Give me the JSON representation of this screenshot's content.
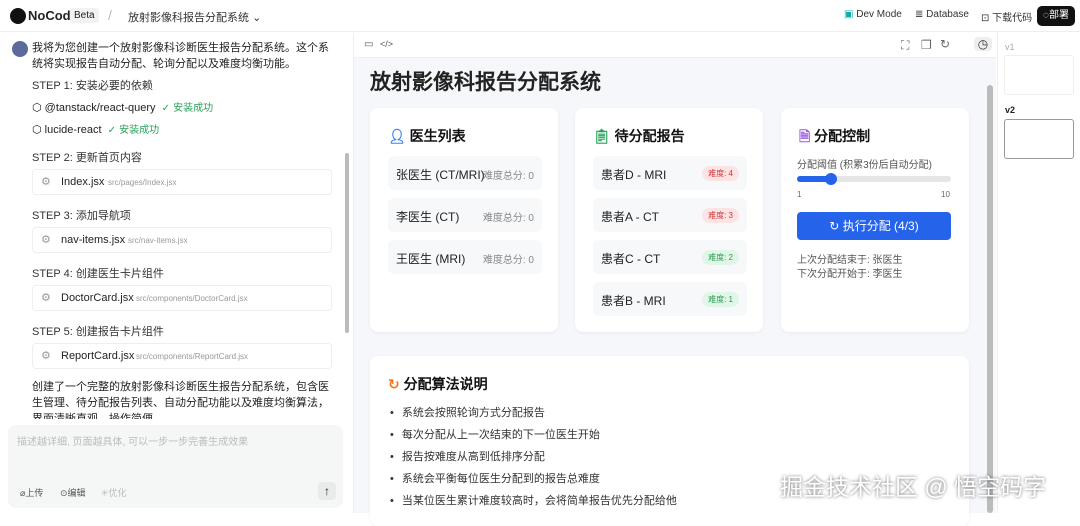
{
  "topbar": {
    "brand": "NoCode",
    "beta": "Beta",
    "project": "放射影像科报告分配系统",
    "dev_mode": "Dev Mode",
    "database": "Database",
    "download": "下载代码",
    "deploy": "部署"
  },
  "chat": {
    "intro": "我将为您创建一个放射影像科诊断医生报告分配系统。这个系统将实现报告自动分配、轮询分配以及难度均衡功能。",
    "step1": "STEP 1: 安装必要的依赖",
    "deps": [
      {
        "name": "@tanstack/react-query",
        "status": "安装成功"
      },
      {
        "name": "lucide-react",
        "status": "安装成功"
      }
    ],
    "steps": [
      {
        "title": "STEP 2: 更新首页内容",
        "file": "Index.jsx",
        "path": "src/pages/Index.jsx"
      },
      {
        "title": "STEP 3: 添加导航项",
        "file": "nav-items.jsx",
        "path": "src/nav-items.jsx"
      },
      {
        "title": "STEP 4: 创建医生卡片组件",
        "file": "DoctorCard.jsx",
        "path": "src/components/DoctorCard.jsx"
      },
      {
        "title": "STEP 5: 创建报告卡片组件",
        "file": "ReportCard.jsx",
        "path": "src/components/ReportCard.jsx"
      }
    ],
    "summary": "创建了一个完整的放射影像科诊断医生报告分配系统，包含医生管理、待分配报告列表、自动分配功能以及难度均衡算法，界面清晰直观，操作简便。",
    "input_placeholder": "描述越详细, 页面越具体, 可以一步一步完善生成效果",
    "upload": "上传",
    "edit": "编辑",
    "optimize": "优化"
  },
  "page": {
    "title": "放射影像科报告分配系统",
    "doctors": {
      "title": "医生列表",
      "items": [
        {
          "name": "张医生 (CT/MRI)",
          "score": "难度总分: 0"
        },
        {
          "name": "李医生 (CT)",
          "score": "难度总分: 0"
        },
        {
          "name": "王医生 (MRI)",
          "score": "难度总分: 0"
        }
      ]
    },
    "reports": {
      "title": "待分配报告",
      "items": [
        {
          "name": "患者D - MRI",
          "badge": "难度: 4",
          "level": "high"
        },
        {
          "name": "患者A - CT",
          "badge": "难度: 3",
          "level": "high"
        },
        {
          "name": "患者C - CT",
          "badge": "难度: 2",
          "level": "low"
        },
        {
          "name": "患者B - MRI",
          "badge": "难度: 1",
          "level": "low"
        }
      ]
    },
    "control": {
      "title": "分配控制",
      "threshold_label": "分配阈值 (积累3份后自动分配)",
      "slider_min": "1",
      "slider_max": "10",
      "slider_value": 3,
      "button": "执行分配 (4/3)",
      "last": "上次分配结束于: 张医生",
      "next": "下次分配开始于: 李医生"
    },
    "algo": {
      "title": "分配算法说明",
      "items": [
        "系统会按照轮询方式分配报告",
        "每次分配从上一次结束的下一位医生开始",
        "报告按难度从高到低排序分配",
        "系统会平衡每位医生分配到的报告总难度",
        "当某位医生累计难度较高时，会将简单报告优先分配给他"
      ]
    }
  },
  "versions": {
    "v1": "v1",
    "v2": "v2"
  },
  "watermark": "掘金技术社区 @ 悟空码字",
  "colors": {
    "primary": "#2563eb"
  }
}
